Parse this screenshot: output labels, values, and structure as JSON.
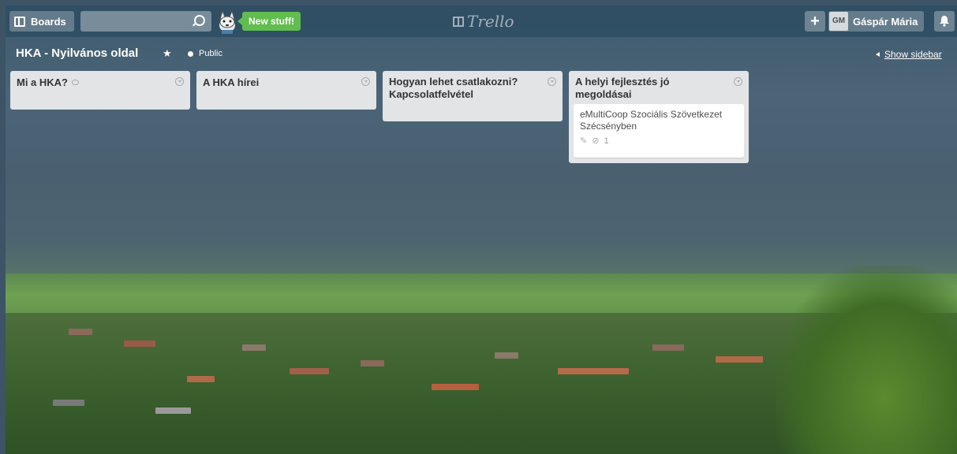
{
  "header": {
    "boards_label": "Boards",
    "search_value": "",
    "new_stuff_label": "New stuff!",
    "logo_text": "Trello",
    "add_label": "+",
    "member_initials": "GM",
    "member_name": "Gáspár Mária",
    "bell_icon": "bell-icon"
  },
  "board": {
    "title": "HKA - Nyilvános oldal",
    "star_icon": "★",
    "visibility": "Public",
    "show_sidebar_label": "Show sidebar"
  },
  "lists": [
    {
      "title": "Mi a HKA?",
      "has_subscribed_icon": true,
      "cards": []
    },
    {
      "title": "A HKA hírei",
      "cards": []
    },
    {
      "title": "Hogyan lehet csatlakozni? Kapcsolatfelvétel",
      "cards": []
    },
    {
      "title": "A helyi fejlesztés jó megoldásai",
      "cards": [
        {
          "title": "eMultiCoop Szociális Szövetkezet Szécsényben",
          "attachments": "1"
        }
      ]
    }
  ],
  "colors": {
    "accent_green": "#61bd4f",
    "list_bg": "#e2e4e6"
  }
}
